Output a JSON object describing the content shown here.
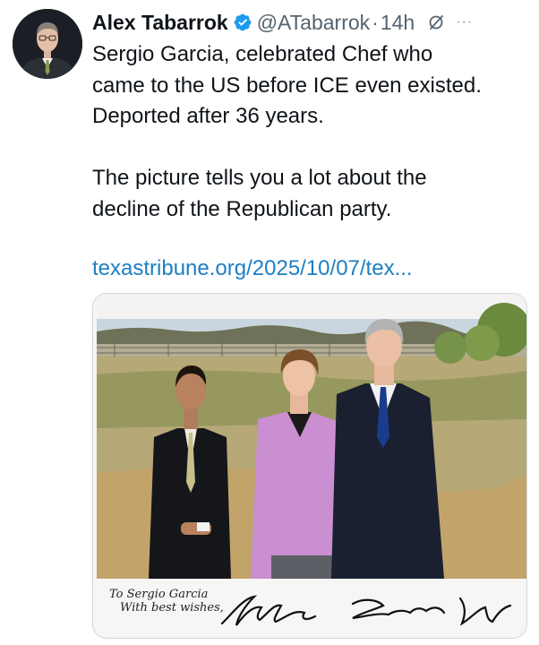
{
  "tweet": {
    "author": {
      "name": "Alex Tabarrok",
      "handle": "@ATabarrok",
      "verified": true,
      "avatar_icon": "profile-photo"
    },
    "separator": "·",
    "time": "14h",
    "more_icon": "more-icon",
    "more_label": "···",
    "grok_icon": "grok-icon",
    "paragraphs": [
      [
        "Sergio Garcia, celebrated Chef who",
        "came to the US before ICE even existed.",
        "Deported after 36 years."
      ],
      [
        "The picture tells you a lot about the",
        "decline of the Republican party."
      ]
    ],
    "link": "texastribune.org/2025/10/07/tex...",
    "media": {
      "type": "photo",
      "inscription_line1": "To Sergio Garcia",
      "inscription_line2": "With best wishes,",
      "signature_text": "George W. Bush, Laura Bush"
    }
  },
  "colors": {
    "text": "#0f1419",
    "secondary": "#536471",
    "link": "#1d7fc2",
    "verified": "#1d9bf0"
  }
}
